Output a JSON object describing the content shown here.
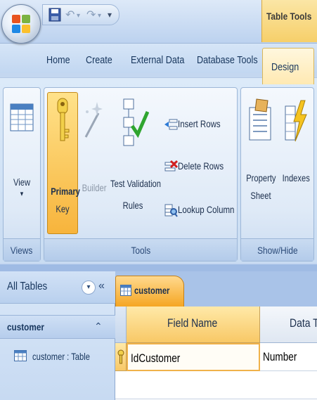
{
  "title_bar": {
    "contextual_tab_group": "Table Tools"
  },
  "tabs": [
    {
      "label": "Home"
    },
    {
      "label": "Create"
    },
    {
      "label": "External Data"
    },
    {
      "label": "Database Tools"
    },
    {
      "label": "Design",
      "active": true
    }
  ],
  "ribbon": {
    "views": {
      "label": "Views",
      "view_button": "View",
      "view_arrow": "▾"
    },
    "tools": {
      "label": "Tools",
      "primary_key": [
        "Primary",
        "Key"
      ],
      "builder": "Builder",
      "test_validation": [
        "Test Validation",
        "Rules"
      ],
      "insert_rows": "Insert Rows",
      "delete_rows": "Delete Rows",
      "lookup_column": "Lookup Column"
    },
    "show_hide": {
      "label": "Show/Hide",
      "property_sheet": [
        "Property",
        "Sheet"
      ],
      "indexes": "Indexes"
    }
  },
  "nav_pane": {
    "title": "All Tables",
    "group": "customer",
    "items": [
      {
        "label": "customer : Table"
      }
    ]
  },
  "document": {
    "tab_label": "customer",
    "columns": [
      "Field Name",
      "Data T"
    ],
    "rows": [
      {
        "field_name": "IdCustomer",
        "data_type": "Number",
        "primary_key": true
      }
    ]
  },
  "colors": {
    "accent_orange": "#f5a623",
    "ribbon_blue": "#c9dcf2",
    "text_navy": "#17365d"
  }
}
